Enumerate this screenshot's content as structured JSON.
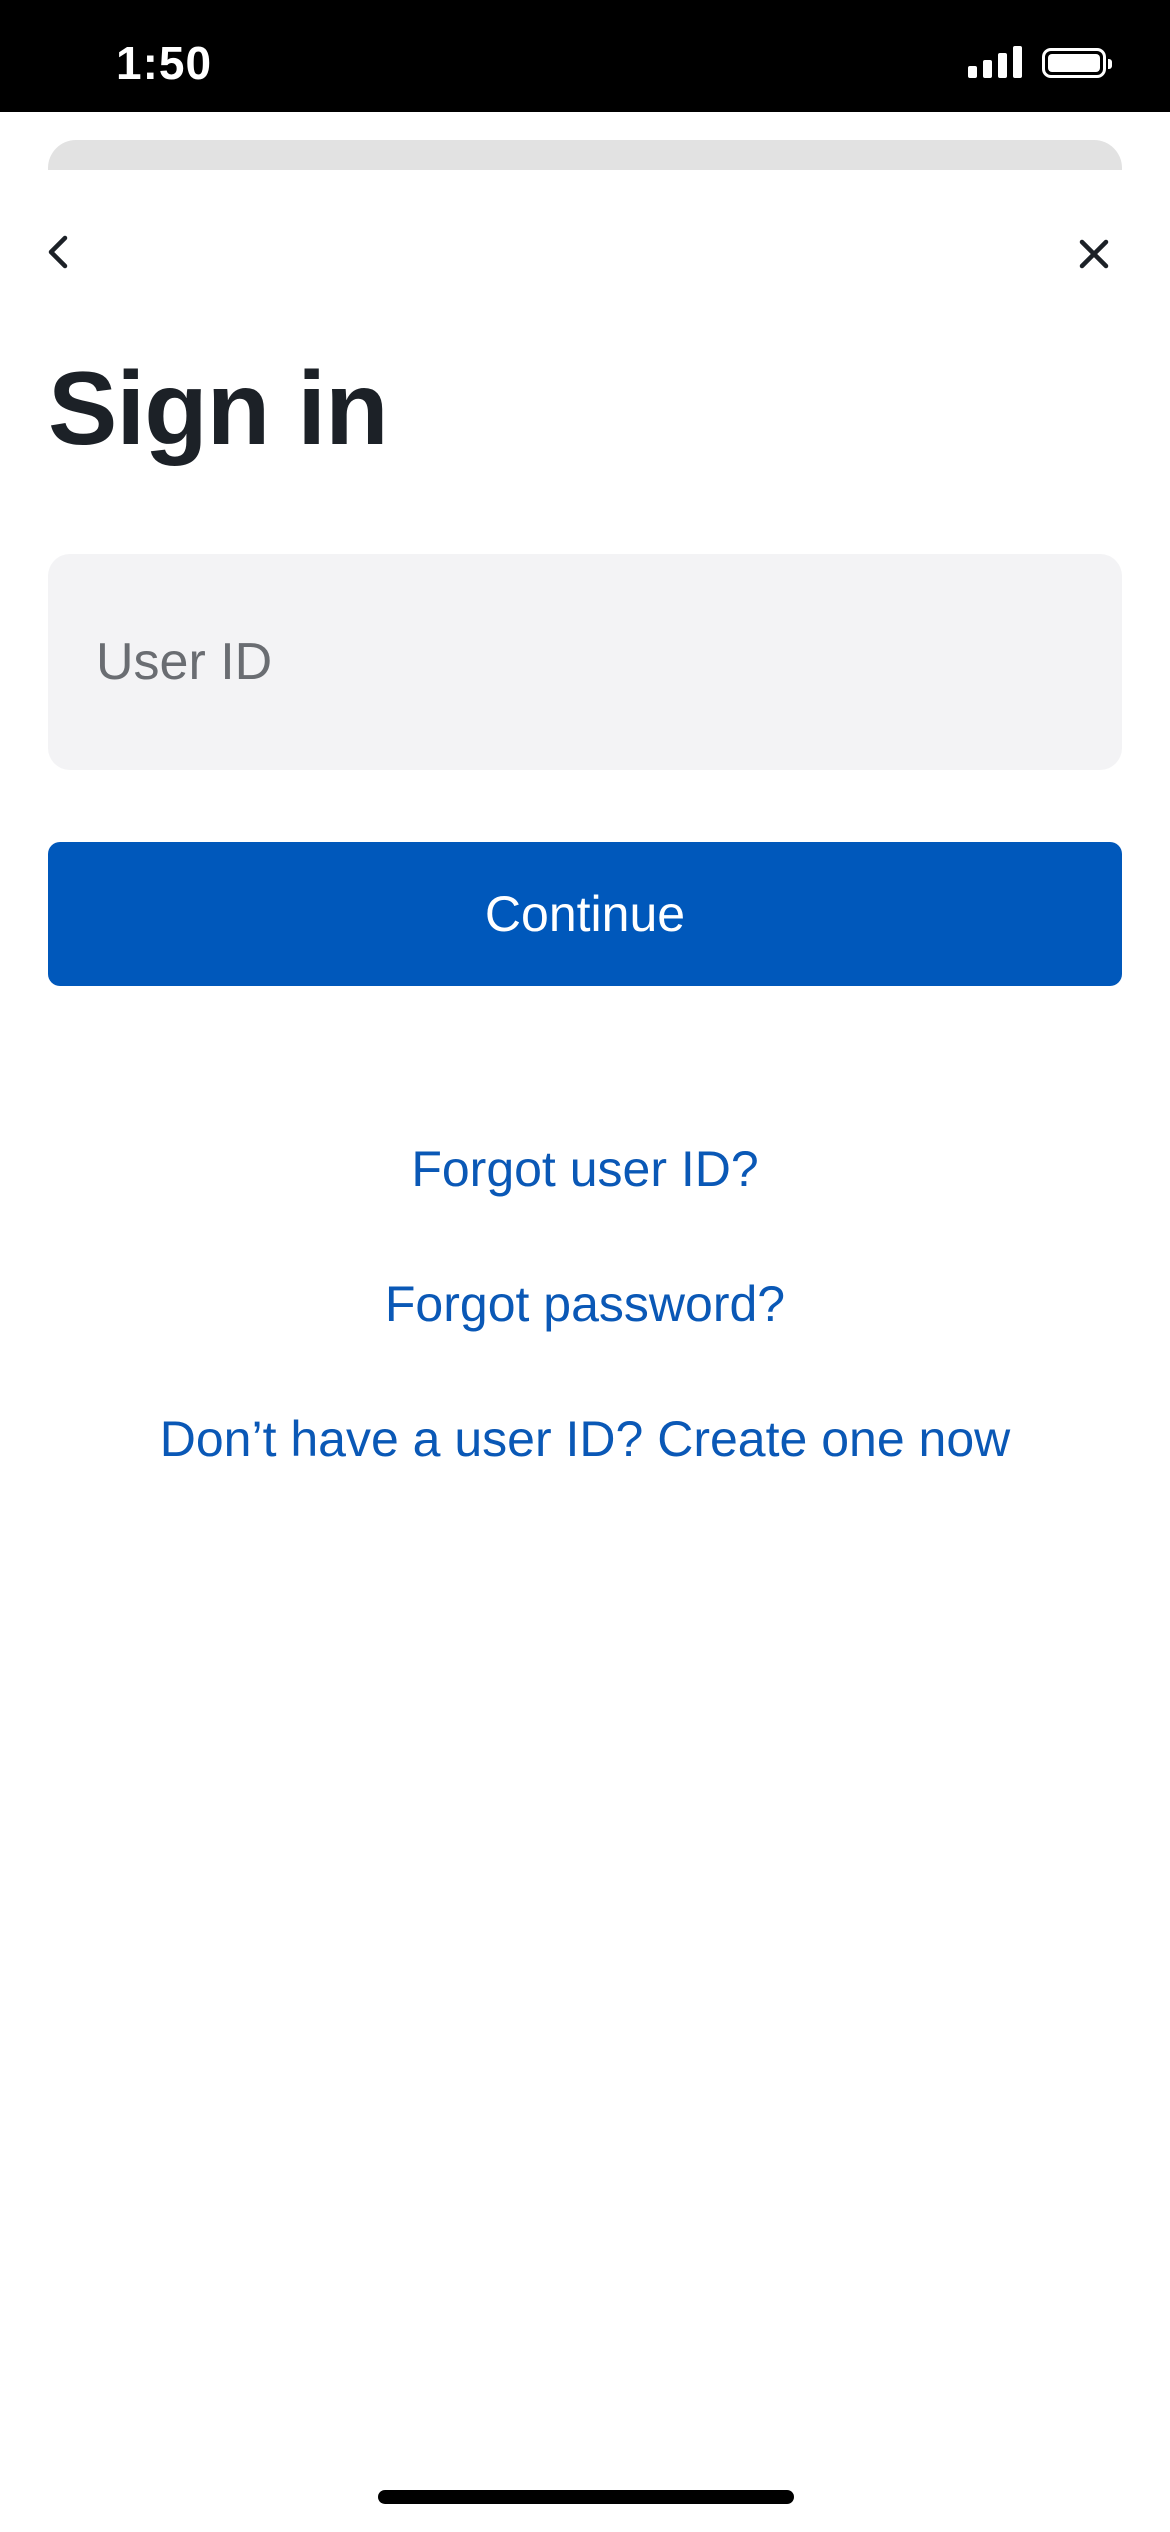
{
  "status_bar": {
    "time": "1:50"
  },
  "nav": {
    "back_icon": "chevron-left-icon",
    "close_icon": "close-icon"
  },
  "page": {
    "title": "Sign in"
  },
  "form": {
    "user_id": {
      "value": "",
      "placeholder": "User ID"
    },
    "continue_label": "Continue"
  },
  "links": {
    "forgot_user_id": "Forgot user ID?",
    "forgot_password": "Forgot password?",
    "create_account": "Don’t have a user ID? Create one now"
  },
  "colors": {
    "primary": "#0058bb",
    "link": "#0a58b6",
    "title": "#1c2127",
    "input_bg": "#f3f3f5"
  }
}
